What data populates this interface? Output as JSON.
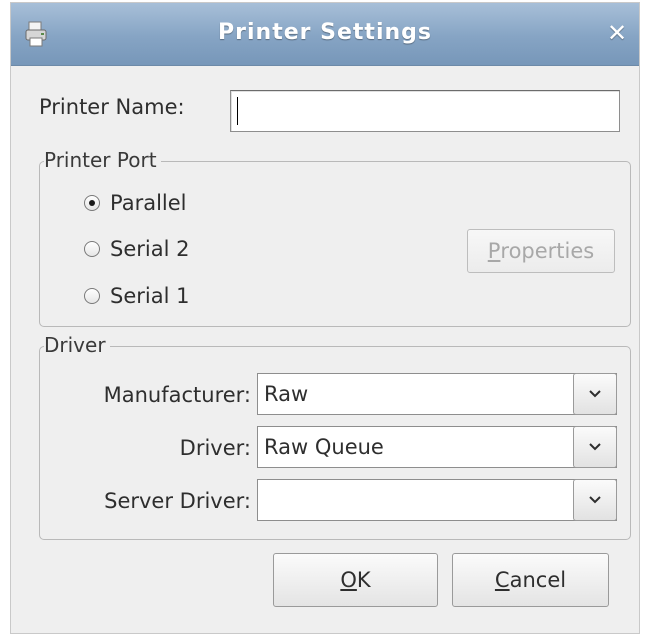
{
  "window": {
    "title": "Printer Settings",
    "close_glyph": "✕",
    "app_icon": "printer-icon"
  },
  "printer_name": {
    "label": "Printer Name:",
    "value": ""
  },
  "printer_port": {
    "legend": "Printer Port",
    "options": [
      {
        "label": "Parallel",
        "checked": true
      },
      {
        "label": "Serial 2",
        "checked": false
      },
      {
        "label": "Serial 1",
        "checked": false
      }
    ],
    "properties_button": {
      "mnemonic": "P",
      "rest": "roperties",
      "enabled": false
    }
  },
  "driver": {
    "legend": "Driver",
    "manufacturer": {
      "label": "Manufacturer:",
      "value": "Raw"
    },
    "driver": {
      "label": "Driver:",
      "value": "Raw Queue"
    },
    "server_driver": {
      "label": "Server Driver:",
      "value": ""
    }
  },
  "buttons": {
    "ok": {
      "mnemonic": "O",
      "rest": "K"
    },
    "cancel": {
      "mnemonic": "C",
      "rest": "ancel"
    }
  },
  "colors": {
    "titlebar": "#86a4c4",
    "window_bg": "#efefef"
  }
}
